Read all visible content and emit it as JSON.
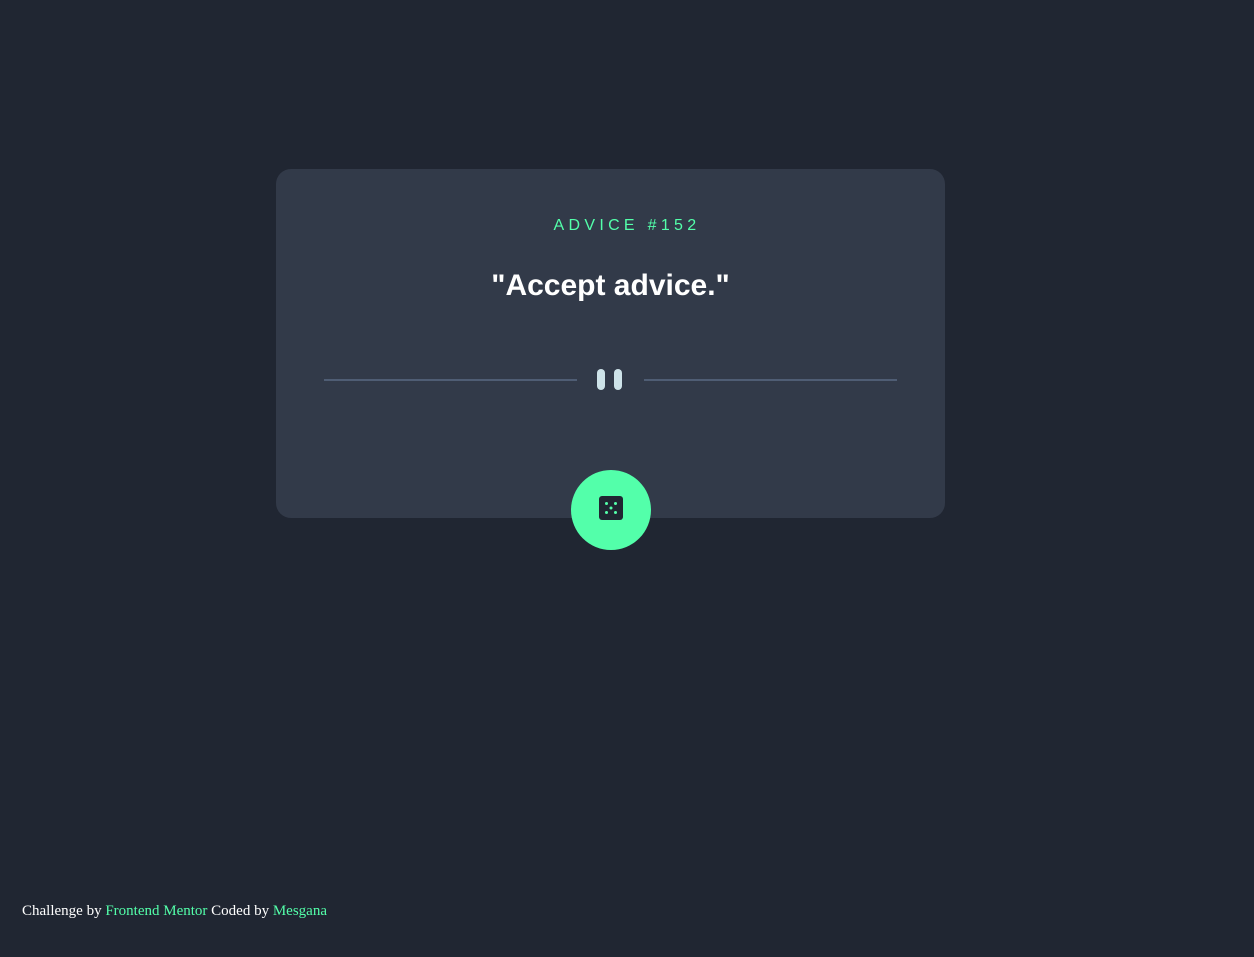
{
  "advice": {
    "id_label": "ADVICE #152",
    "text": "\"Accept advice.\""
  },
  "button": {
    "icon": "dice-icon"
  },
  "divider": {
    "icon": "pause-icon"
  },
  "footer": {
    "prefix": "Challenge by",
    "challenge_link": "Frontend Mentor",
    "middle": "Coded by",
    "author_link": "Mesgana"
  },
  "colors": {
    "background": "#202632",
    "card": "#323a49",
    "accent": "#53ffaa",
    "divider": "#4f5d74",
    "text": "#ffffff",
    "pause": "#cee3e9"
  }
}
